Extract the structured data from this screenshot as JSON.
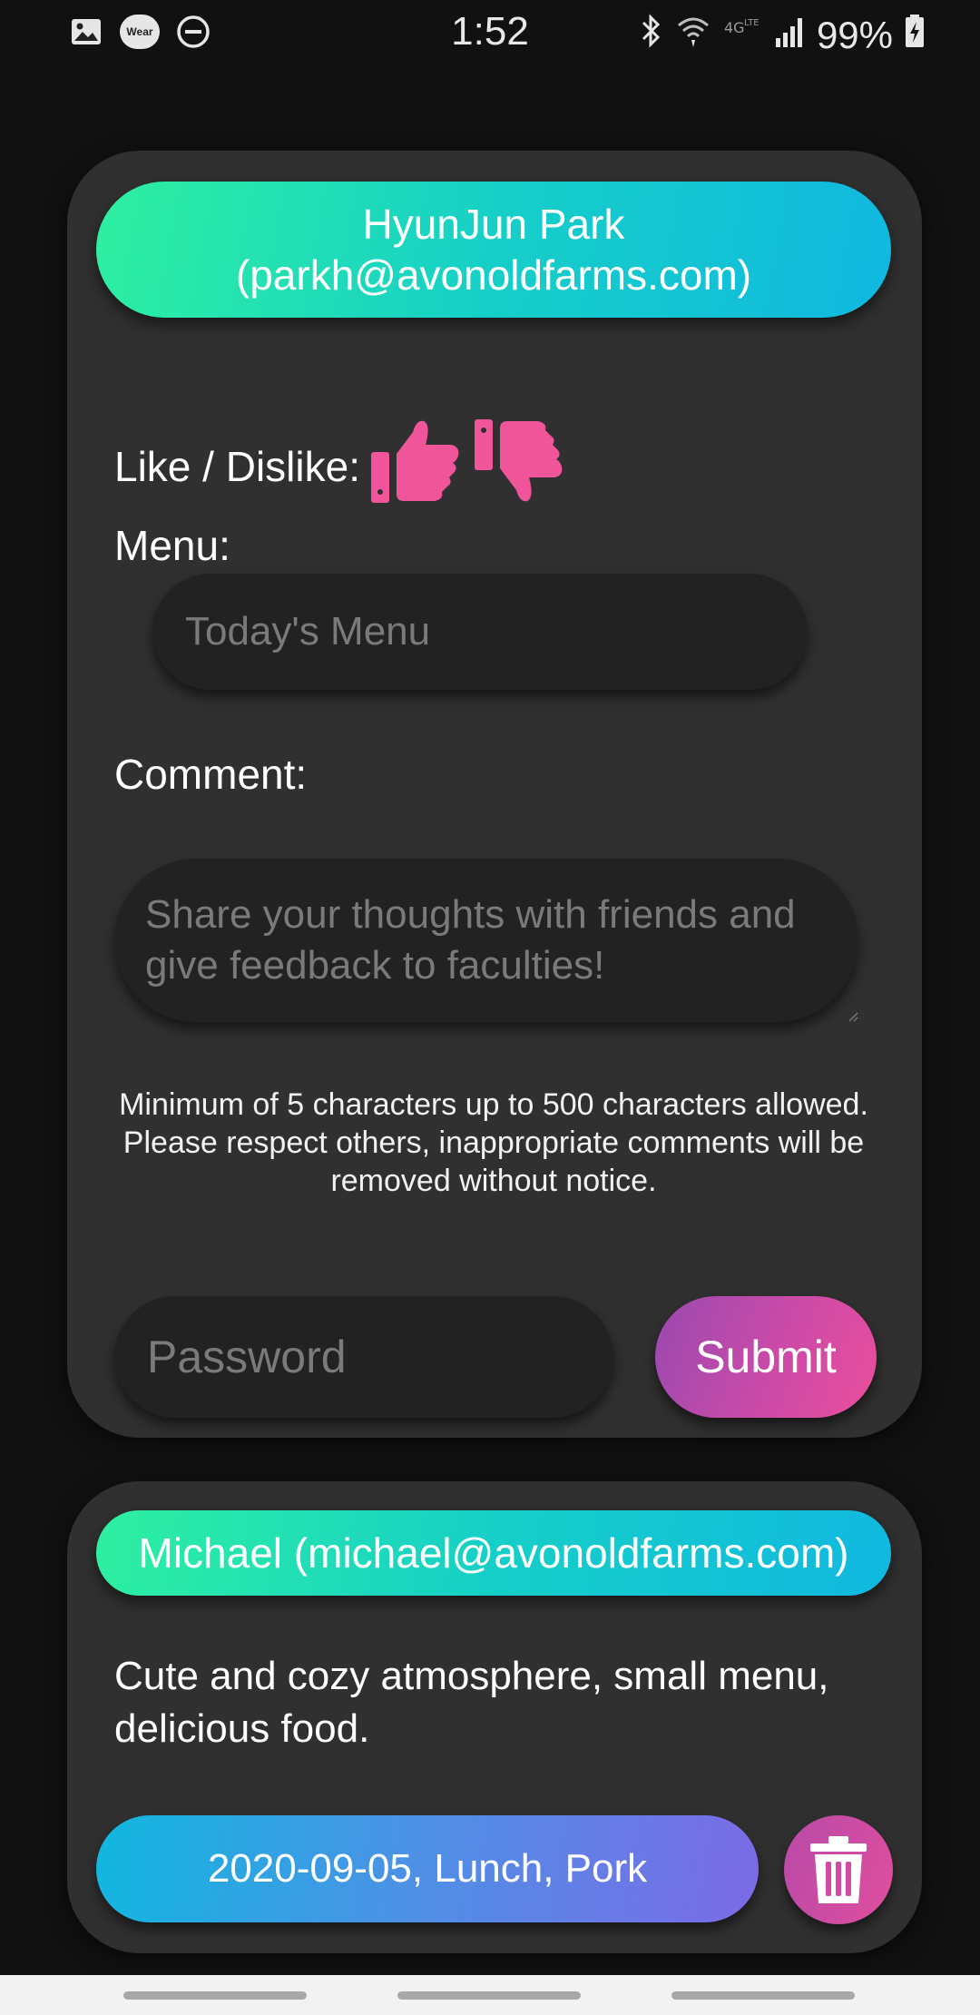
{
  "status_bar": {
    "time": "1:52",
    "battery": "99%",
    "wear_label": "Wear",
    "left_icons": [
      "gallery-icon",
      "wear-icon",
      "do-not-disturb-icon"
    ],
    "right_icons": [
      "bluetooth-icon",
      "wifi-icon",
      "lte-icon",
      "signal-icon",
      "battery-charging-icon"
    ]
  },
  "compose": {
    "user_line1": "HyunJun Park",
    "user_line2": "(parkh@avonoldfarms.com)",
    "like_label": "Like / Dislike:",
    "like_icons": [
      "thumbs-up-icon",
      "thumbs-down-icon"
    ],
    "menu_label": "Menu:",
    "menu_placeholder": "Today's Menu",
    "comment_label": "Comment:",
    "comment_placeholder": "Share your thoughts with friends and give feedback to faculties!",
    "notice_line1": "Minimum of 5 characters up to 500 characters allowed.",
    "notice_line2": "Please respect others, inappropriate comments will be removed without notice.",
    "password_placeholder": "Password",
    "submit_label": "Submit"
  },
  "review": {
    "user": "Michael (michael@avonoldfarms.com)",
    "text": "Cute and cozy atmosphere, small menu, delicious food.",
    "meta": "2020-09-05, Lunch, Pork",
    "delete_icon": "trash-icon"
  },
  "colors": {
    "background": "#111111",
    "card": "#303030",
    "input": "#222222",
    "accent_pink": "#f0559a",
    "name_gradient": [
      "#2ef0a0",
      "#10b8e0"
    ],
    "submit_gradient": [
      "#9a49b0",
      "#ea4e9c"
    ],
    "meta_gradient": [
      "#10b8e0",
      "#7c6ae6"
    ]
  }
}
